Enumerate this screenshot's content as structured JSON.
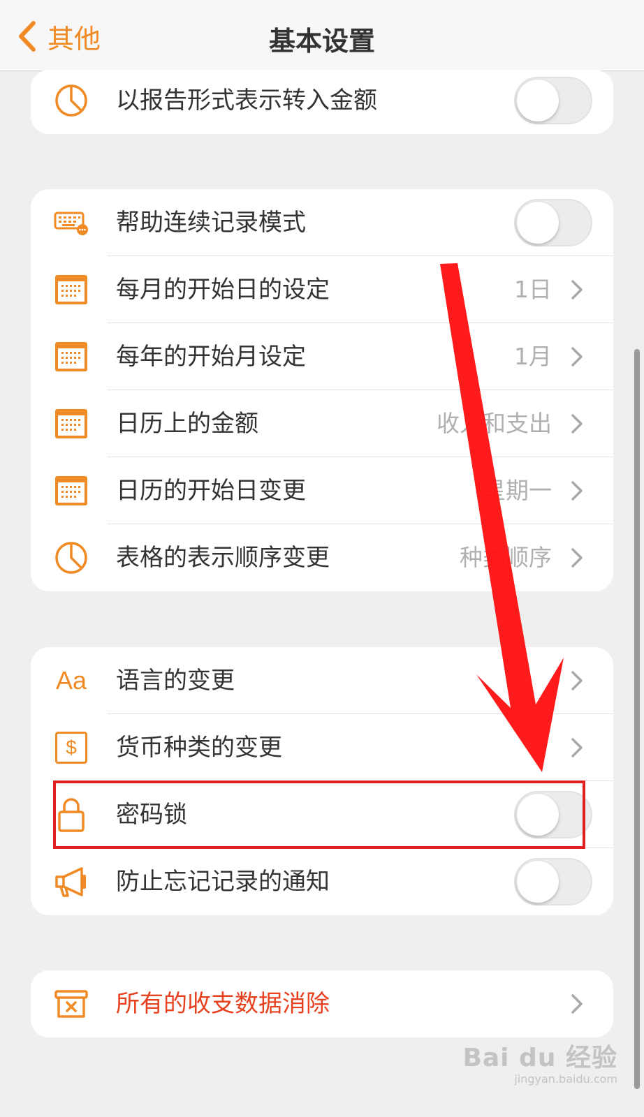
{
  "navbar": {
    "back_label": "其他",
    "title": "基本设置"
  },
  "colors": {
    "accent": "#f08a24",
    "danger": "#e8411f",
    "highlight": "#e02020"
  },
  "section1": {
    "rows": [
      {
        "label": "以报告形式表示转入金额",
        "icon": "pie-chart-icon",
        "toggle": "off"
      }
    ]
  },
  "section2": {
    "rows": [
      {
        "label": "帮助连续记录模式",
        "icon": "keyboard-icon",
        "toggle": "off"
      },
      {
        "label": "每月的开始日的设定",
        "value": "1日",
        "icon": "calendar-icon"
      },
      {
        "label": "每年的开始月设定",
        "value": "1月",
        "icon": "calendar-icon"
      },
      {
        "label": "日历上的金额",
        "value": "收入和支出",
        "icon": "calendar-icon"
      },
      {
        "label": "日历的开始日变更",
        "value": "星期一",
        "icon": "calendar-icon"
      },
      {
        "label": "表格的表示顺序变更",
        "value": "种类顺序",
        "icon": "pie-chart-icon"
      }
    ]
  },
  "section3": {
    "rows": [
      {
        "label": "语言的变更",
        "icon_text": "Aa",
        "icon": "language-icon"
      },
      {
        "label": "货币种类的变更",
        "icon_text": "$",
        "icon": "currency-icon"
      },
      {
        "label": "密码锁",
        "icon": "lock-icon",
        "toggle": "off"
      },
      {
        "label": "防止忘记记录的通知",
        "icon": "megaphone-icon",
        "toggle": "off"
      }
    ]
  },
  "section4": {
    "rows": [
      {
        "label": "所有的收支数据消除",
        "icon": "trash-box-icon"
      }
    ]
  },
  "watermark": {
    "main": "Bai du 经验",
    "sub": "jingyan.baidu.com"
  }
}
